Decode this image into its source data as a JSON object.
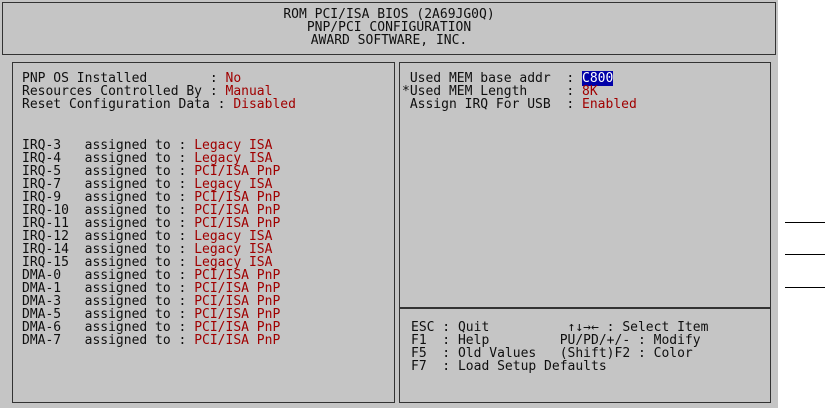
{
  "header": {
    "line1": "ROM PCI/ISA BIOS (2A69JG0Q)",
    "line2": "PNP/PCI CONFIGURATION",
    "line3": "AWARD SOFTWARE, INC."
  },
  "left": {
    "settings": [
      {
        "label": "PNP OS Installed        : ",
        "value": "No"
      },
      {
        "label": "Resources Controlled By : ",
        "value": "Manual"
      },
      {
        "label": "Reset Configuration Data : ",
        "value": "Disabled"
      }
    ],
    "irq": [
      {
        "label": "IRQ-3   assigned to : ",
        "value": "Legacy ISA"
      },
      {
        "label": "IRQ-4   assigned to : ",
        "value": "Legacy ISA"
      },
      {
        "label": "IRQ-5   assigned to : ",
        "value": "PCI/ISA PnP"
      },
      {
        "label": "IRQ-7   assigned to : ",
        "value": "Legacy ISA"
      },
      {
        "label": "IRQ-9   assigned to : ",
        "value": "PCI/ISA PnP"
      },
      {
        "label": "IRQ-10  assigned to : ",
        "value": "PCI/ISA PnP"
      },
      {
        "label": "IRQ-11  assigned to : ",
        "value": "PCI/ISA PnP"
      },
      {
        "label": "IRQ-12  assigned to : ",
        "value": "Legacy ISA"
      },
      {
        "label": "IRQ-14  assigned to : ",
        "value": "Legacy ISA"
      },
      {
        "label": "IRQ-15  assigned to : ",
        "value": "Legacy ISA"
      }
    ],
    "dma": [
      {
        "label": "DMA-0   assigned to : ",
        "value": "PCI/ISA PnP"
      },
      {
        "label": "DMA-1   assigned to : ",
        "value": "PCI/ISA PnP"
      },
      {
        "label": "DMA-3   assigned to : ",
        "value": "PCI/ISA PnP"
      },
      {
        "label": "DMA-5   assigned to : ",
        "value": "PCI/ISA PnP"
      },
      {
        "label": "DMA-6   assigned to : ",
        "value": "PCI/ISA PnP"
      },
      {
        "label": "DMA-7   assigned to : ",
        "value": "PCI/ISA PnP"
      }
    ]
  },
  "right": {
    "settings": [
      {
        "label": " Used MEM base addr  : ",
        "value": "C800",
        "selected": true
      },
      {
        "label": "*Used MEM Length     : ",
        "value": "8K"
      },
      {
        "label": " Assign IRQ For USB  : ",
        "value": "Enabled"
      }
    ]
  },
  "help": {
    "lines": [
      "ESC : Quit          ↑↓→← : Select Item",
      "F1  : Help         PU/PD/+/- : Modify",
      "F5  : Old Values   (Shift)F2 : Color",
      "F7  : Load Setup Defaults"
    ]
  },
  "colors": {
    "background": "#c5c5c5",
    "value": "#a00000",
    "highlight": "#0000a8"
  }
}
